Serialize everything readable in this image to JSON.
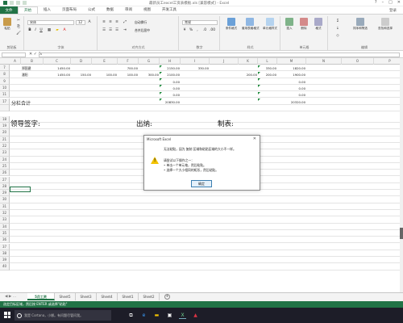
{
  "window": {
    "title": "最新员工excel工资表模板.xls [兼容模式] - Excel",
    "controls": [
      "?",
      "–",
      "□",
      "✕"
    ]
  },
  "ribbon": {
    "file_tab": "文件",
    "tabs": [
      "开始",
      "插入",
      "页面布局",
      "公式",
      "数据",
      "审阅",
      "视图",
      "开发工具"
    ],
    "active_tab": "开始",
    "login": "登录",
    "paste_label": "粘贴",
    "font_name": "宋体",
    "font_size": "12",
    "wrap_label": "自动换行",
    "merge_label": "合并后居中",
    "number_format": "常规",
    "cond_format_label": "条件格式",
    "table_format_label": "套用表格格式",
    "cell_style_label": "单元格样式",
    "insert_label": "插入",
    "delete_label": "删除",
    "format_label": "格式",
    "sort_label": "排序和筛选",
    "find_label": "查找和选择",
    "groups": [
      "剪贴板",
      "字体",
      "对齐方式",
      "数字",
      "样式",
      "单元格",
      "编辑"
    ]
  },
  "formula_bar": {
    "fx": "fx",
    "cancel": "✕",
    "enter": "✓"
  },
  "columns": [
    "A",
    "B",
    "C",
    "D",
    "E",
    "F",
    "G",
    "H",
    "I",
    "J",
    "K",
    "L",
    "M",
    "N",
    "O",
    "P"
  ],
  "rows": [
    {
      "num": "7",
      "cells": [
        "",
        "郑国建",
        "1450.00",
        "",
        "",
        "700.00",
        "",
        "2150.00",
        "330.00",
        "",
        "",
        "330.00",
        "1820.00"
      ]
    },
    {
      "num": "8",
      "cells": [
        "",
        "潘阳",
        "1450.00",
        "150.00",
        "100.00",
        "100.00",
        "300.00",
        "2100.00",
        "",
        "",
        "200.00",
        "200.00",
        "1900.00"
      ]
    },
    {
      "num": "9",
      "cells": [
        "",
        "",
        "",
        "",
        "",
        "",
        "",
        "0.00",
        "",
        "",
        "",
        "",
        "0.00"
      ]
    },
    {
      "num": "10",
      "cells": [
        "",
        "",
        "",
        "",
        "",
        "",
        "",
        "0.00",
        "",
        "",
        "",
        "",
        "0.00"
      ]
    },
    {
      "num": "11",
      "cells": [
        "",
        "",
        "",
        "",
        "",
        "",
        "",
        "0.00",
        "",
        "",
        "",
        "",
        "0.00"
      ]
    },
    {
      "num": "17",
      "cells": [
        "分栏合计",
        "",
        "",
        "",
        "",
        "",
        "",
        "20830.00",
        "",
        "",
        "",
        "",
        "20320.00"
      ]
    }
  ],
  "footer_labels": {
    "leader": "领导签字:",
    "cashier": "出纳:",
    "maker": "制表:"
  },
  "extra_row_numbers": [
    "18",
    "19",
    "20",
    "21",
    "22",
    "23",
    "24",
    "25",
    "26",
    "27",
    "28",
    "29",
    "30",
    "31",
    "32",
    "33",
    "34",
    "35",
    "36",
    "37",
    "38",
    "39",
    "40"
  ],
  "dialog": {
    "title": "Microsoft Excel",
    "close": "✕",
    "line1": "无法粘贴，因为 复制 区域和粘贴区域的大小不一样。",
    "line2": "请尝试以下操作之一：",
    "line3": "• 单击一个单元格，然后粘贴。",
    "line4": "• 选择一个大小相同的矩形，然后粘贴。",
    "ok": "确定"
  },
  "sheets": [
    "5月工资",
    "Sheet5",
    "Sheet3",
    "Sheet4",
    "Sheet1",
    "Sheet2"
  ],
  "active_sheet": "5月工资",
  "sheet_add": "+",
  "status_text": "选定目标区域，然后按 ENTER 或选择\"粘贴\"",
  "taskbar": {
    "search_placeholder": "我是 Cortana，小娜。有问题尽管问我。"
  },
  "colors": {
    "excel_green": "#217346",
    "taskbar": "#1d1d28",
    "warning": "#f2c200"
  }
}
